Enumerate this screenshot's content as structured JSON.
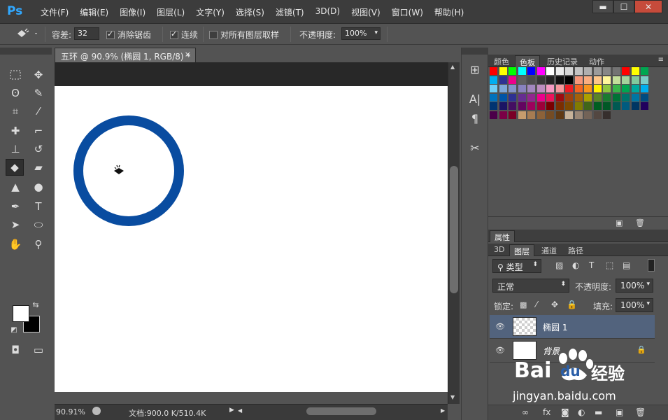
{
  "app": {
    "logo": "Ps"
  },
  "menu": [
    "文件(F)",
    "编辑(E)",
    "图像(I)",
    "图层(L)",
    "文字(Y)",
    "选择(S)",
    "滤镜(T)",
    "3D(D)",
    "视图(V)",
    "窗口(W)",
    "帮助(H)"
  ],
  "window_controls": {
    "minimize": "▬",
    "maximize": "☐",
    "close": "✕"
  },
  "options": {
    "tolerance_label": "容差:",
    "tolerance_value": "32",
    "antialias_label": "消除锯齿",
    "contiguous_label": "连续",
    "all_layers_label": "对所有图层取样",
    "opacity_label": "不透明度:",
    "opacity_value": "100%"
  },
  "document": {
    "tab_title": "五环 @ 90.9% (椭圆 1, RGB/8) *",
    "tab_close": "×",
    "zoom": "90.91%",
    "doc_info": "文档:900.0 K/510.4K",
    "ring_color": "#094ca0"
  },
  "swatches_panel": {
    "tabs": [
      "颜色",
      "色板",
      "历史记录",
      "动作"
    ],
    "active_tab": "色板"
  },
  "properties_panel": {
    "title": "属性"
  },
  "layers_panel": {
    "tabs": [
      "3D",
      "图层",
      "通道",
      "路径"
    ],
    "filter_label": "类型",
    "blend_mode": "正常",
    "opacity_label": "不透明度:",
    "opacity_value": "100%",
    "lock_label": "锁定:",
    "fill_label": "填充:",
    "fill_value": "100%",
    "layers": [
      {
        "name": "椭圆 1",
        "selected": true
      },
      {
        "name": "背景",
        "selected": false
      }
    ]
  },
  "watermark": {
    "brand": "Bai",
    "brand2": "du",
    "cn": "经验",
    "url": "jingyan.baidu.com"
  }
}
